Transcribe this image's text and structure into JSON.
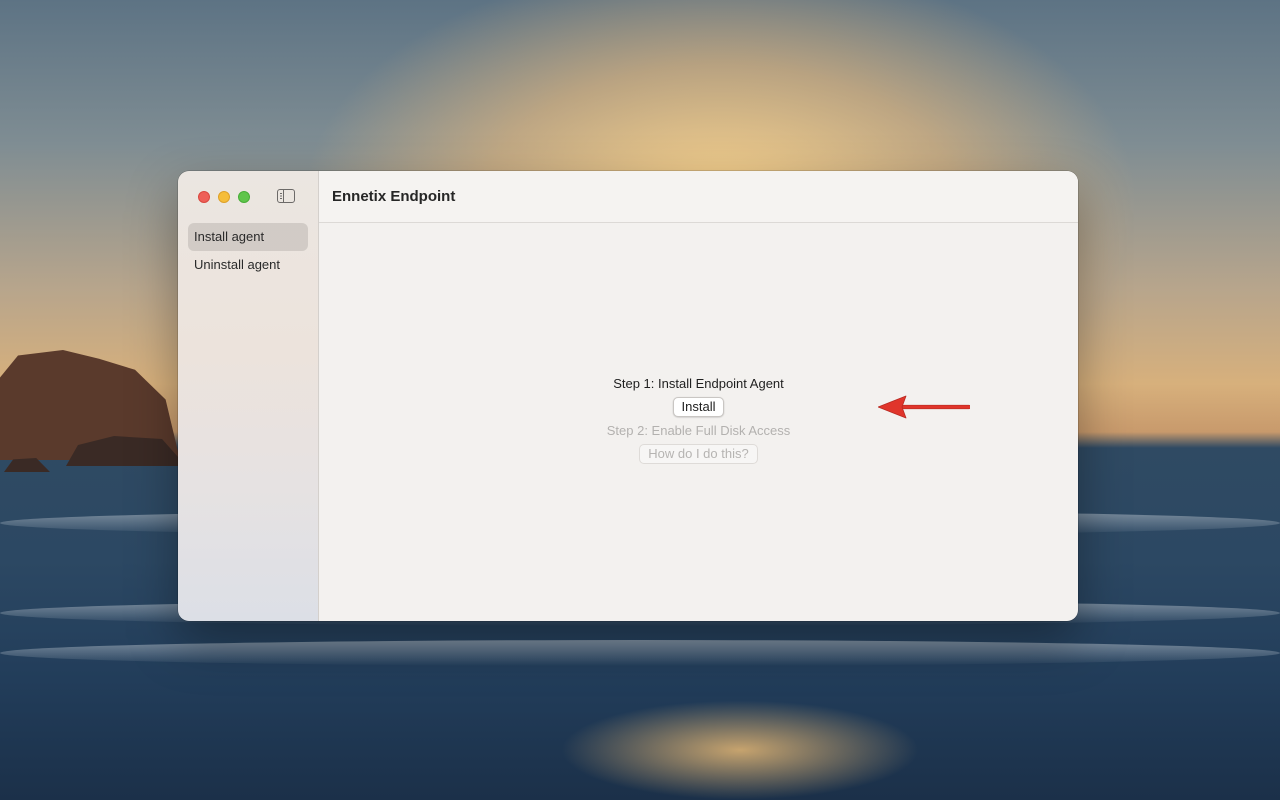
{
  "window": {
    "title": "Ennetix Endpoint"
  },
  "sidebar": {
    "items": [
      {
        "label": "Install agent",
        "selected": true
      },
      {
        "label": "Uninstall agent",
        "selected": false
      }
    ]
  },
  "main": {
    "step1_label": "Step 1: Install Endpoint Agent",
    "install_button": "Install",
    "step2_label": "Step 2: Enable Full Disk Access",
    "help_button": "How do I do this?"
  },
  "annotation": {
    "arrow_color": "#e0352b"
  },
  "colors": {
    "close": "#ee5f58",
    "minimize": "#f5bd3a",
    "zoom": "#5fc54b"
  }
}
